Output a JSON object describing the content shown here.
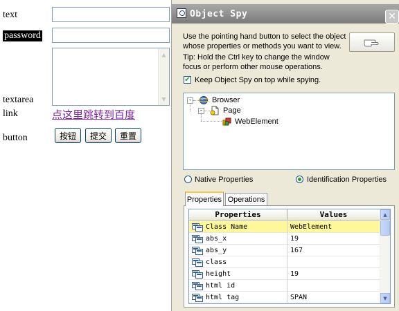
{
  "webpage": {
    "text_label": "text",
    "password_label": "password",
    "textarea_label": "textarea",
    "link_label": "link",
    "link_text": "点这里跳转到百度",
    "button_label": "button",
    "buttons": [
      "按钮",
      "提交",
      "重置"
    ]
  },
  "object_spy": {
    "title": "Object Spy",
    "instructions": [
      "Use the pointing hand button to select the object",
      "whose properties or methods you want to view.",
      "Tip: Hold the Ctrl key to change the window",
      "focus or perform other mouse operations."
    ],
    "keep_on_top_label": "Keep Object Spy on top while spying.",
    "keep_on_top_checked": true,
    "tree": [
      {
        "label": "Browser",
        "icon": "browser-globe-icon"
      },
      {
        "label": "Page",
        "icon": "page-icon"
      },
      {
        "label": "WebElement",
        "icon": "web-element-icon"
      }
    ],
    "radio_native": "Native Properties",
    "radio_identification": "Identification Properties",
    "selected_radio": "Identification Properties",
    "tabs": [
      "Properties",
      "Operations"
    ],
    "active_tab": "Properties",
    "table": {
      "headers": [
        "Properties",
        "Values"
      ],
      "rows": [
        {
          "name": "Class Name",
          "value": "WebElement",
          "selected": true
        },
        {
          "name": "abs_x",
          "value": "19"
        },
        {
          "name": "abs_y",
          "value": "167"
        },
        {
          "name": "class",
          "value": ""
        },
        {
          "name": "height",
          "value": "19"
        },
        {
          "name": "html id",
          "value": ""
        },
        {
          "name": "html tag",
          "value": "SPAN"
        }
      ]
    },
    "colors": {
      "selected_row": "#fff799",
      "titlebar": "#8c8c8c",
      "window_bg": "#ece9d8",
      "link": "#7b1fa2"
    }
  }
}
